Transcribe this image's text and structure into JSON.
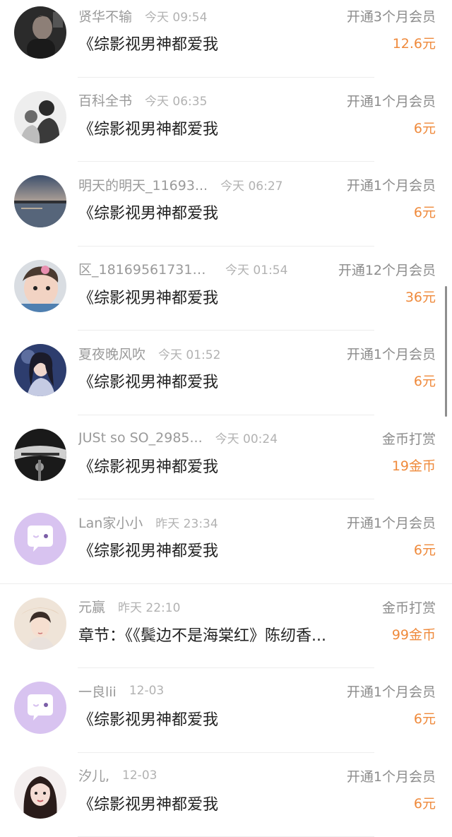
{
  "items": [
    {
      "user": "贤华不输",
      "time": "今天 09:54",
      "action": "开通3个月会员",
      "title": "《综影视男神都爱我",
      "amount": "12.6元",
      "avatar": "photo-dark-portrait"
    },
    {
      "user": "百科全书",
      "time": "今天 06:35",
      "action": "开通1个月会员",
      "title": "《综影视男神都爱我",
      "amount": "6元",
      "avatar": "photo-sketch-couple"
    },
    {
      "user": "明天的明天_11693...",
      "time": "今天 06:27",
      "action": "开通1个月会员",
      "title": "《综影视男神都爱我",
      "amount": "6元",
      "avatar": "photo-sunset-lake"
    },
    {
      "user": "区_181695617316...",
      "time": "今天 01:54",
      "action": "开通12个月会员",
      "title": "《综影视男神都爱我",
      "amount": "36元",
      "avatar": "photo-baby"
    },
    {
      "user": "夏夜晚风吹",
      "time": "今天 01:52",
      "action": "开通1个月会员",
      "title": "《综影视男神都爱我",
      "amount": "6元",
      "avatar": "photo-fantasy-girl"
    },
    {
      "user": "JUSt so SO_2985...",
      "time": "今天 00:24",
      "action": "金币打赏",
      "title": "《综影视男神都爱我",
      "amount": "19金币",
      "avatar": "photo-bw-hands"
    },
    {
      "user": "Lan家小小",
      "time": "昨天 23:34",
      "action": "开通1个月会员",
      "title": "《综影视男神都爱我",
      "amount": "6元",
      "avatar": "default-chat-bubble"
    },
    {
      "user": "元赢",
      "time": "昨天 22:10",
      "action": "金币打赏",
      "title": "章节：《《鬓边不是海棠红》陈纫香...",
      "amount": "99金币",
      "avatar": "illustration-portrait"
    },
    {
      "user": "一良lii",
      "time": "12-03",
      "action": "开通1个月会员",
      "title": "《综影视男神都爱我",
      "amount": "6元",
      "avatar": "default-chat-bubble"
    },
    {
      "user": "汐儿,",
      "time": "12-03",
      "action": "开通1个月会员",
      "title": "《综影视男神都爱我",
      "amount": "6元",
      "avatar": "photo-woman-portrait"
    }
  ],
  "colors": {
    "username": "#9a9a9a",
    "time": "#b2b2b2",
    "action": "#8c8c8c",
    "title": "#222222",
    "amount": "#ef8a3c",
    "default_avatar_bg": "#d8c3f0"
  }
}
